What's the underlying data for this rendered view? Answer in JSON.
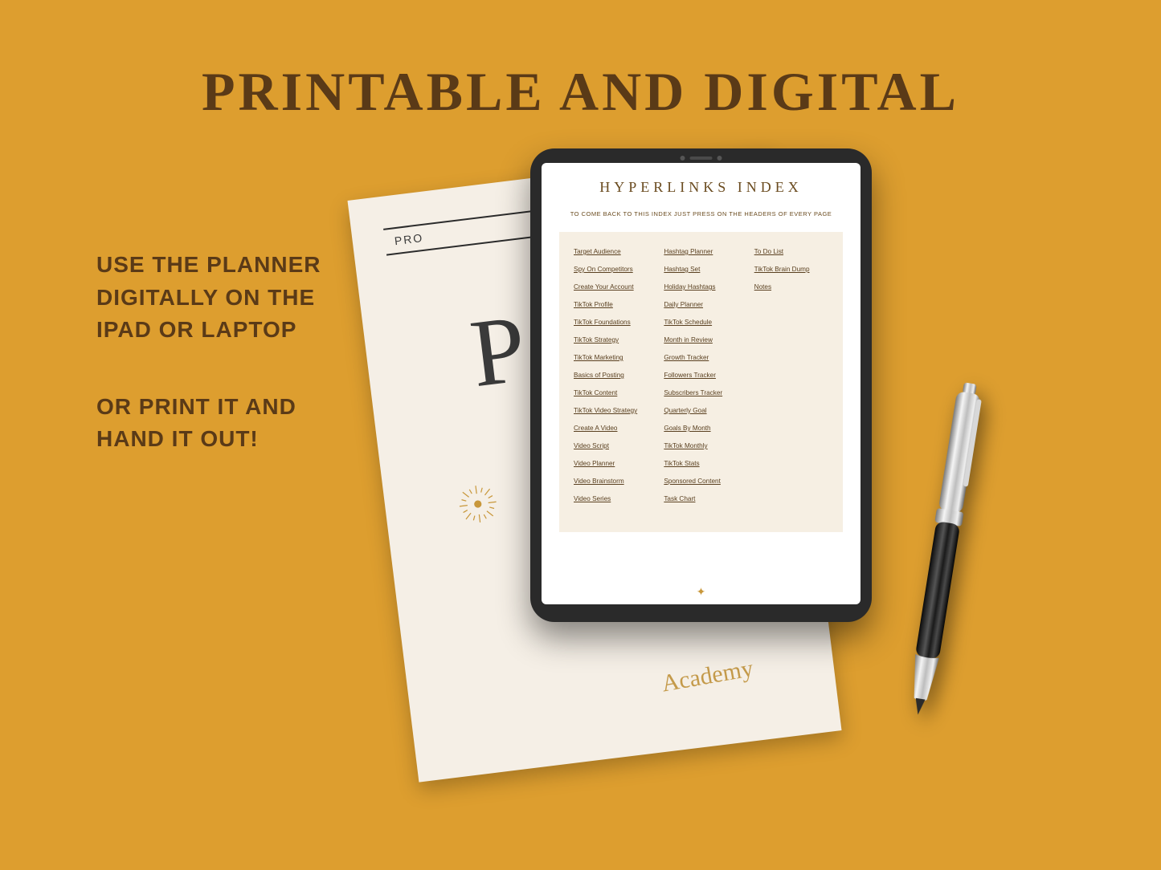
{
  "headline": "PRINTABLE AND DIGITAL",
  "copy": {
    "para1": "USE THE PLANNER DIGITALLY ON THE IPAD OR LAPTOP",
    "para2": "OR PRINT IT AND HAND IT OUT!"
  },
  "paper": {
    "topline_partial": "PRO",
    "big_letter": "P",
    "script": "Academy"
  },
  "tablet": {
    "title": "HYPERLINKS INDEX",
    "subtitle": "TO COME BACK TO THIS INDEX JUST PRESS ON THE HEADERS OF EVERY PAGE",
    "columns": [
      [
        "Target Audience",
        "Spy On Competitors",
        "Create Your Account",
        "TikTok Profile",
        "TikTok Foundations",
        "TikTok Strategy",
        "TikTok Marketing",
        "Basics of Posting",
        "TikTok Content",
        "TikTok Video Strategy",
        "Create A Video",
        "Video Script",
        "Video Planner",
        "Video Brainstorm",
        "Video Series"
      ],
      [
        "Hashtag Planner",
        "Hashtag Set",
        "Holiday Hashtags",
        "Daily Planner",
        "TikTok Schedule",
        "Month in Review",
        "Growth Tracker",
        "Followers Tracker",
        "Subscribers Tracker",
        "Quarterly Goal",
        "Goals By Month",
        "TikTok Monthly",
        "TikTok Stats",
        "Sponsored Content",
        "Task Chart"
      ],
      [
        "To Do List",
        "TikTok Brain Dump",
        "Notes"
      ]
    ]
  }
}
